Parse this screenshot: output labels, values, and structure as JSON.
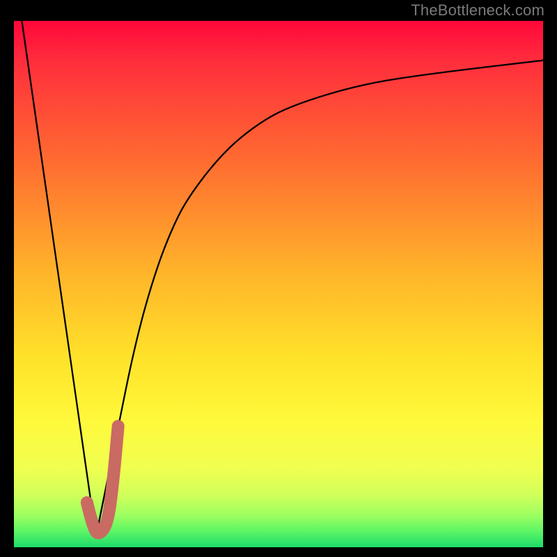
{
  "watermark": "TheBottleneck.com",
  "colors": {
    "frame": "#000000",
    "curve": "#000000",
    "highlight": "#c96a63",
    "gradient_stops": [
      "#ff073a",
      "#ff2f3c",
      "#ff7030",
      "#ffb52a",
      "#ffe22a",
      "#fff93b",
      "#f0ff50",
      "#d1ff5a",
      "#9cff60",
      "#5cf565",
      "#1ddc6b"
    ]
  },
  "chart_data": {
    "type": "line",
    "title": "",
    "xlabel": "",
    "ylabel": "",
    "xlim": [
      0,
      1
    ],
    "ylim": [
      0,
      100
    ],
    "series": [
      {
        "name": "left-linear",
        "x": [
          0.015,
          0.155
        ],
        "y": [
          100,
          2
        ]
      },
      {
        "name": "right-curve",
        "x": [
          0.155,
          0.197,
          0.23,
          0.263,
          0.296,
          0.329,
          0.395,
          0.461,
          0.526,
          0.658,
          0.789,
          1.0
        ],
        "y": [
          2,
          23,
          39,
          51,
          60,
          66.5,
          75,
          80.5,
          84,
          88,
          90,
          92.5
        ]
      }
    ],
    "highlight_segment": {
      "description": "J-shaped salmon overlay near the minimum",
      "points_x": [
        0.138,
        0.151,
        0.164,
        0.178,
        0.188,
        0.197
      ],
      "points_y": [
        8.5,
        3,
        2.5,
        5,
        13,
        23
      ]
    }
  }
}
